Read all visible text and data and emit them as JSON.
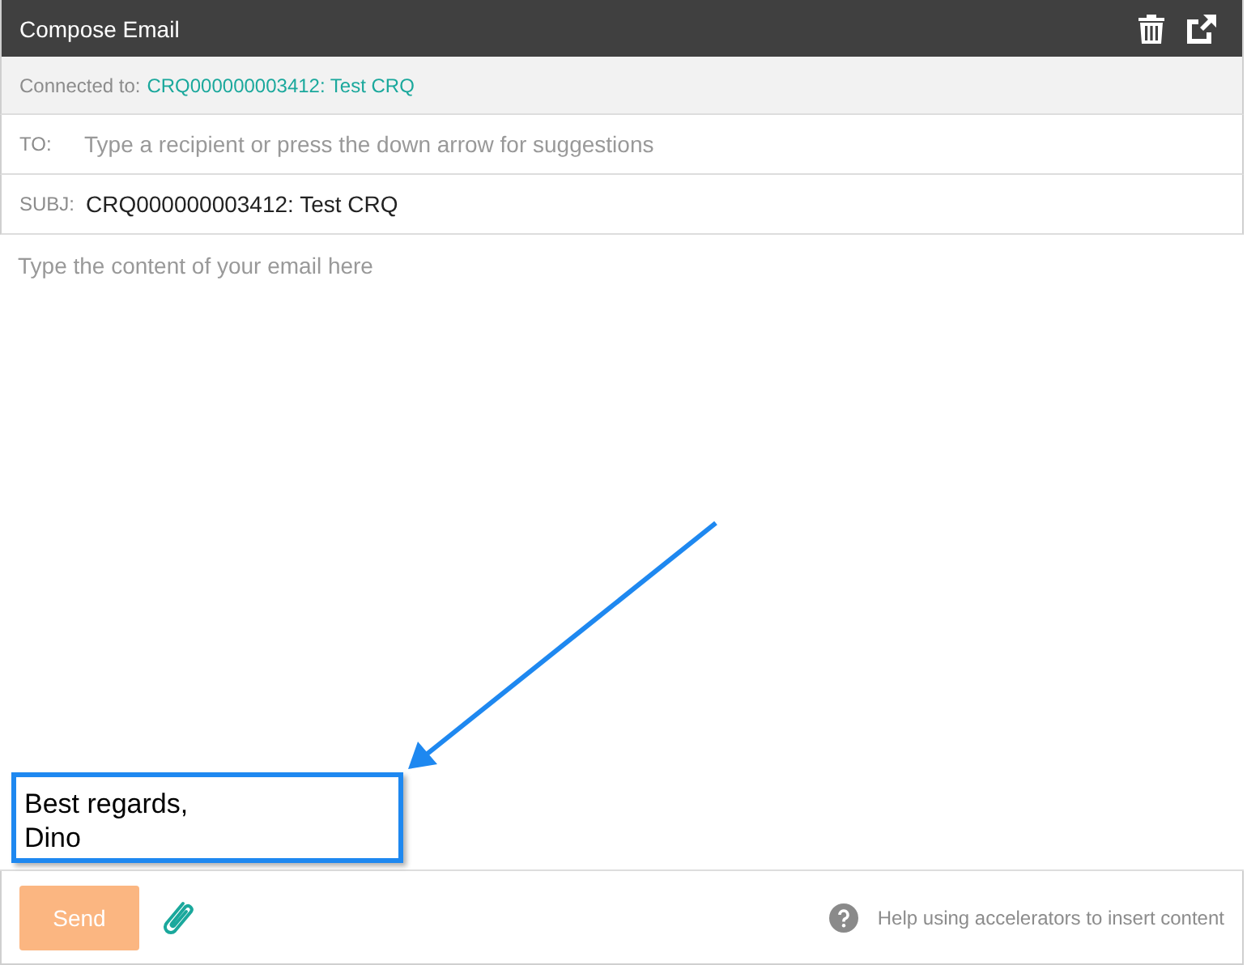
{
  "window": {
    "title": "Compose Email"
  },
  "connected": {
    "label": "Connected to:",
    "link": "CRQ000000003412: Test CRQ"
  },
  "to": {
    "label": "TO:",
    "placeholder": "Type a recipient or press the down arrow for suggestions"
  },
  "subject": {
    "label": "SUBJ:",
    "value": "CRQ000000003412: Test CRQ"
  },
  "body": {
    "placeholder": "Type the content of your email here"
  },
  "callout": {
    "lines": [
      "Best regards,",
      "Dino"
    ]
  },
  "footer": {
    "send": {
      "label": "Send",
      "disabled": true
    },
    "help": "Help using accelerators to insert content"
  }
}
